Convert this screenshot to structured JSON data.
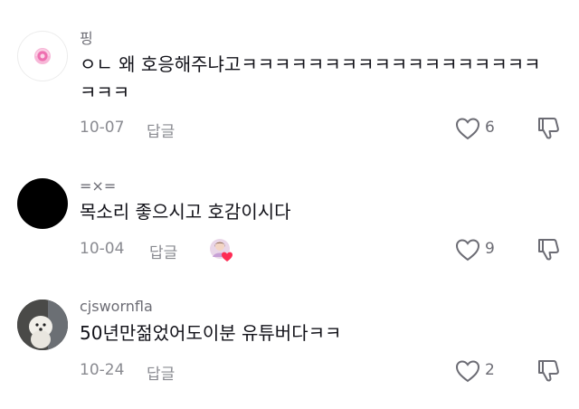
{
  "comments": [
    {
      "username": "핑",
      "text": "ㅇㄴ 왜 호응해주냐고ㅋㅋㅋㅋㅋㅋㅋㅋㅋㅋㅋㅋㅋㅋㅋㅋㅋㅋㅋㅋㅋ",
      "date": "10-07",
      "reply_label": "답글",
      "likes": "6"
    },
    {
      "username": "=×=",
      "text": "목소리 좋으시고 호감이시다",
      "date": "10-04",
      "reply_label": "답글",
      "likes": "9"
    },
    {
      "username": "cjswornfla",
      "text": "50년만젊었어도이분 유튜버다ㅋㅋ",
      "date": "10-24",
      "reply_label": "답글",
      "likes": "2"
    }
  ],
  "colors": {
    "text": "#161823",
    "secondary": "#8a8b91",
    "heart_badge": "#fe2c55"
  },
  "icons": {
    "like": "heart-outline-icon",
    "dislike": "thumbs-down-icon",
    "creator_like": "creator-liked-badge-icon"
  }
}
